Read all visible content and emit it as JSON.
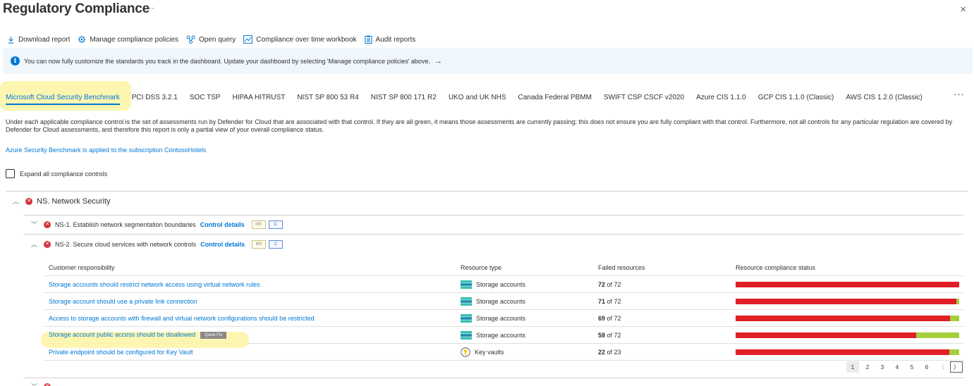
{
  "page": {
    "title": "Regulatory Compliance",
    "more": "···",
    "close": "×"
  },
  "toolbar": {
    "items": [
      {
        "label": "Download report",
        "icon": "download-icon"
      },
      {
        "label": "Manage compliance policies",
        "icon": "gear-icon"
      },
      {
        "label": "Open query",
        "icon": "query-icon"
      },
      {
        "label": "Compliance over time workbook",
        "icon": "chart-icon"
      },
      {
        "label": "Audit reports",
        "icon": "clipboard-icon"
      }
    ]
  },
  "info_bar": {
    "icon": "info-icon",
    "text": "You can now fully customize the standards you track in the dashboard. Update your dashboard by selecting 'Manage compliance policies' above.",
    "arrow": "→"
  },
  "standards": {
    "tabs": [
      "Microsoft Cloud Security Benchmark",
      "PCI DSS 3.2.1",
      "SOC TSP",
      "HIPAA HITRUST",
      "NIST SP 800 53 R4",
      "NIST SP 800 171 R2",
      "UKO and UK NHS",
      "Canada Federal PBMM",
      "SWIFT CSP CSCF v2020",
      "Azure CIS 1.1.0",
      "GCP CIS 1.1.0 (Classic)",
      "AWS CIS 1.2.0 (Classic)"
    ],
    "active_index": 0,
    "more": "···"
  },
  "description": "Under each applicable compliance control is the set of assessments run by Defender for Cloud that are associated with that control. If they are all green, it means those assessments are currently passing; this does not ensure you are fully compliant with that control. Furthermore, not all controls for any particular regulation are covered by Defender for Cloud assessments, and therefore this report is only a partial view of your overall compliance status.",
  "benchmark_link": "Azure Security Benchmark is applied to the subscription ContosoHotels",
  "expand_all": {
    "label": "Expand all compliance controls",
    "checked": false
  },
  "section": {
    "title": "NS. Network Security",
    "expanded": true
  },
  "controls": [
    {
      "label": "NS-1. Establish network segmentation boundaries",
      "link": "Control details",
      "tags": [
        "MS",
        "C"
      ],
      "expanded": false
    },
    {
      "label": "NS-2. Secure cloud services with network controls",
      "link": "Control details",
      "tags": [
        "MS",
        "C"
      ],
      "expanded": true
    }
  ],
  "table": {
    "headers": [
      "Customer responsibility",
      "Resource type",
      "Failed resources",
      "Resource compliance status"
    ],
    "rows": [
      {
        "name": "Storage accounts should restrict network access using virtual network rules",
        "resource": "Storage accounts",
        "resource_icon": "storage-icon",
        "failed": "72",
        "total": "of 72",
        "failed_fraction": 1.0
      },
      {
        "name": "Storage account should use a private link connection",
        "resource": "Storage accounts",
        "resource_icon": "storage-icon",
        "failed": "71",
        "total": "of 72",
        "failed_fraction": 0.986
      },
      {
        "name": "Access to storage accounts with firewall and virtual network configurations should be restricted",
        "resource": "Storage accounts",
        "resource_icon": "storage-icon",
        "failed": "69",
        "total": "of 72",
        "failed_fraction": 0.958
      },
      {
        "name": "Storage account public access should be disallowed",
        "resource": "Storage accounts",
        "resource_icon": "storage-icon",
        "failed": "58",
        "total": "of 72",
        "failed_fraction": 0.806,
        "quick_fix": "Quick Fix",
        "highlighted": true
      },
      {
        "name": "Private endpoint should be configured for Key Vault",
        "resource": "Key vaults",
        "resource_icon": "key-vault-icon",
        "failed": "22",
        "total": "of 23",
        "failed_fraction": 0.957
      }
    ]
  },
  "pager": {
    "pages": [
      "1",
      "2",
      "3",
      "4",
      "5",
      "6"
    ],
    "active": "1",
    "prev": "〈",
    "next": "〉"
  },
  "colors": {
    "accent": "#0078d4",
    "fail": "#e01f26",
    "pass": "#a4cf3b",
    "error": "#d13438",
    "highlight": "#fdf4a3"
  }
}
